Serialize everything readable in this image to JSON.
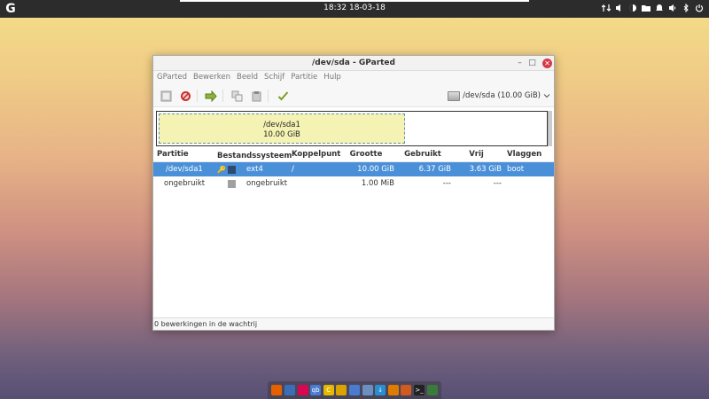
{
  "topbar": {
    "clock": "18:32  18-03-18",
    "activities_glyph": "G",
    "tray_icons": [
      "network-icon",
      "volume-icon",
      "night-light-icon",
      "folder-icon",
      "notification-icon",
      "speaker-icon",
      "bluetooth-icon",
      "power-icon"
    ]
  },
  "window": {
    "title": "/dev/sda - GParted",
    "buttons": {
      "minimize": "–",
      "maximize": "□",
      "close": "✕"
    },
    "menu": [
      "GParted",
      "Bewerken",
      "Beeld",
      "Schijf",
      "Partitie",
      "Hulp"
    ],
    "device_selector": {
      "label": "/dev/sda",
      "size": "(10.00 GiB)"
    },
    "graph": {
      "name": "/dev/sda1",
      "size": "10.00 GiB",
      "color": "#f5f3b3"
    },
    "columns": [
      "Partitie",
      "Bestandssysteem",
      "Koppelpunt",
      "Grootte",
      "Gebruikt",
      "Vrij",
      "Vlaggen"
    ],
    "rows": [
      {
        "partition": "/dev/sda1",
        "filesystem": "ext4",
        "fs_color": "#2e4a6e",
        "mountpoint": "/",
        "size": "10.00 GiB",
        "used": "6.37 GiB",
        "free": "3.63 GiB",
        "flags": "boot",
        "selected": true,
        "key_icon": "🔑"
      },
      {
        "partition": "ongebruikt",
        "filesystem": "ongebruikt",
        "fs_color": "#a0a0a0",
        "mountpoint": "",
        "size": "1.00 MiB",
        "used": "---",
        "free": "---",
        "flags": "",
        "selected": false
      }
    ],
    "status": "0 bewerkingen in de wachtrij"
  },
  "dock": {
    "apps": [
      {
        "name": "firefox-icon",
        "color": "#e66000",
        "glyph": ""
      },
      {
        "name": "thunderbird-icon",
        "color": "#3a6fb8",
        "glyph": ""
      },
      {
        "name": "debian-icon",
        "color": "#d70751",
        "glyph": ""
      },
      {
        "name": "qbittorrent-icon",
        "color": "#4a7bd0",
        "glyph": "qb"
      },
      {
        "name": "ccleaner-icon",
        "color": "#e6b800",
        "glyph": "C"
      },
      {
        "name": "qr-app-icon",
        "color": "#d9a400",
        "glyph": ""
      },
      {
        "name": "calculator-icon",
        "color": "#4a7bd0",
        "glyph": ""
      },
      {
        "name": "files-icon",
        "color": "#6a8fc0",
        "glyph": ""
      },
      {
        "name": "downloader-icon",
        "color": "#2a8fd0",
        "glyph": "↓"
      },
      {
        "name": "vlc-icon",
        "color": "#e07a00",
        "glyph": ""
      },
      {
        "name": "settings-icon",
        "color": "#d05a20",
        "glyph": ""
      },
      {
        "name": "terminal-icon",
        "color": "#222222",
        "glyph": ">_"
      },
      {
        "name": "gparted-icon",
        "color": "#3a7a3a",
        "glyph": ""
      }
    ]
  }
}
